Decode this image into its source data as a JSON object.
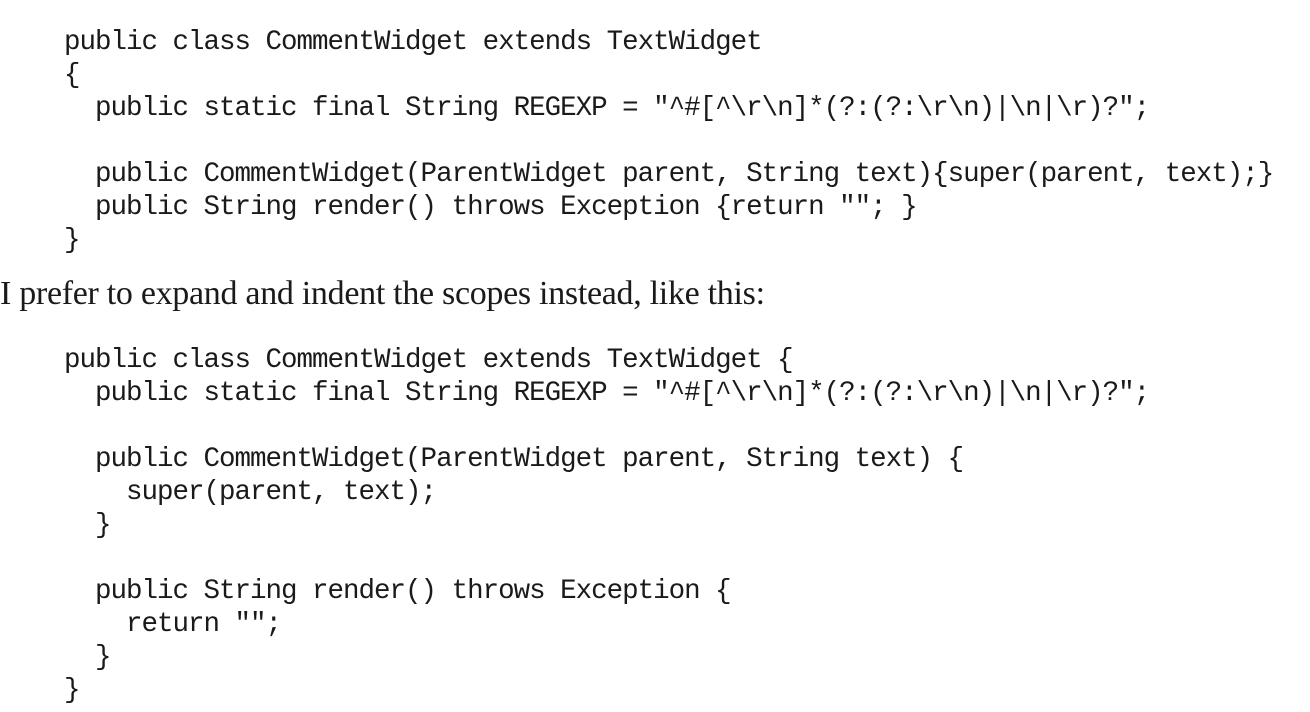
{
  "document": {
    "code_block_1": [
      "public class CommentWidget extends TextWidget",
      "{",
      "  public static final String REGEXP = \"^#[^\\r\\n]*(?:(?:\\r\\n)|\\n|\\r)?\";",
      "",
      "  public CommentWidget(ParentWidget parent, String text){super(parent, text);}",
      "  public String render() throws Exception {return \"\"; }",
      "}"
    ],
    "paragraph": "I prefer to expand and indent the scopes instead, like this:",
    "code_block_2": [
      "public class CommentWidget extends TextWidget {",
      "  public static final String REGEXP = \"^#[^\\r\\n]*(?:(?:\\r\\n)|\\n|\\r)?\";",
      "",
      "  public CommentWidget(ParentWidget parent, String text) {",
      "    super(parent, text);",
      "  }",
      "",
      "  public String render() throws Exception {",
      "    return \"\";",
      "  }",
      "}"
    ]
  }
}
